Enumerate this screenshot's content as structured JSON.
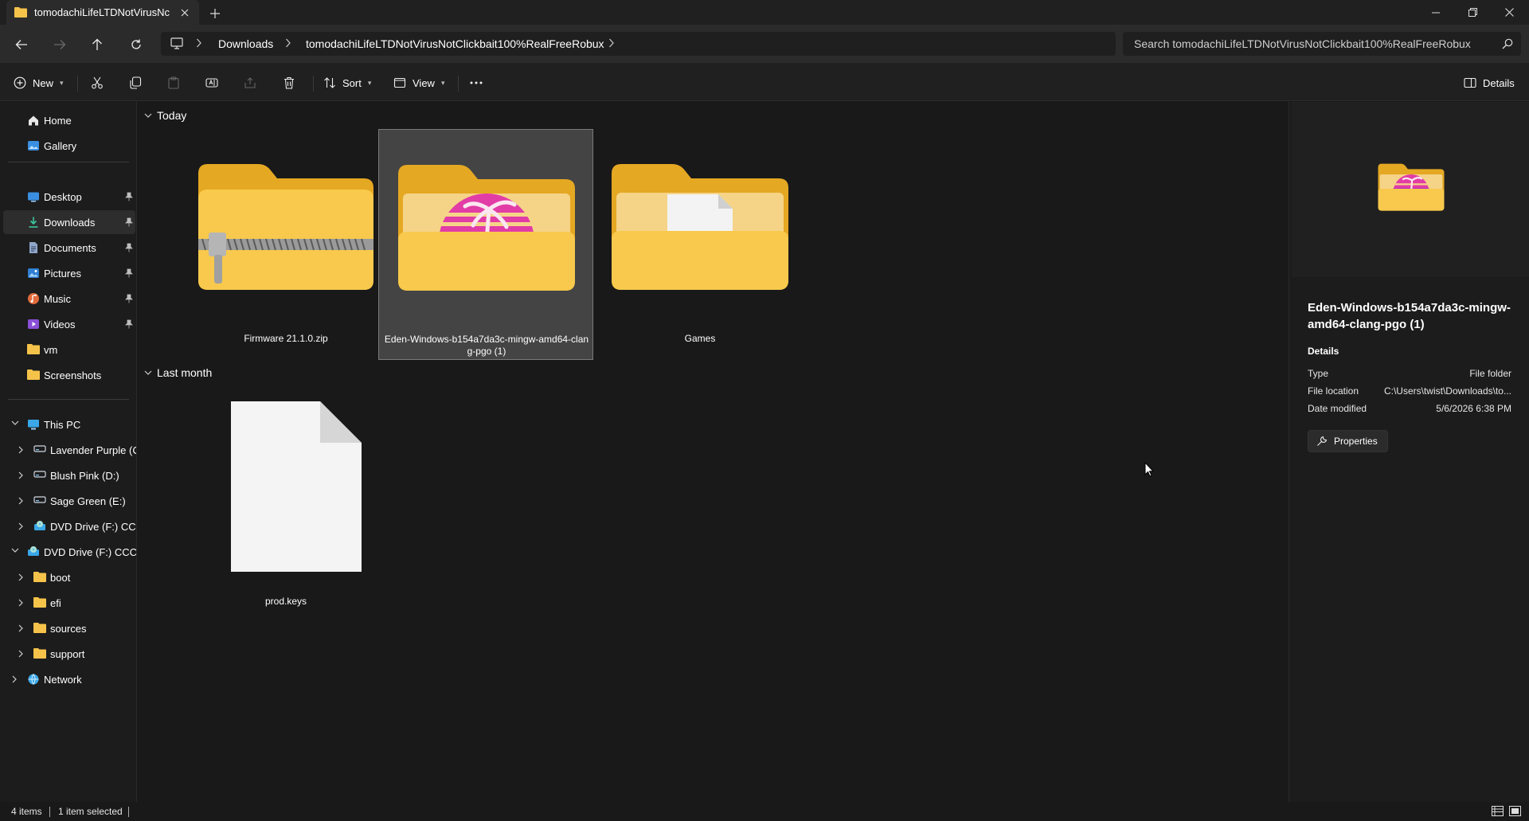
{
  "tab": {
    "title": "tomodachiLifeLTDNotVirusNc",
    "close_icon": "close-icon",
    "new_tab_label": "+"
  },
  "window_controls": [
    "minimize-icon",
    "restore-icon",
    "close-icon"
  ],
  "address_bar": {
    "breadcrumbs": [
      "Downloads",
      "tomodachiLifeLTDNotVirusNotClickbait100%RealFreeRobux"
    ],
    "search_placeholder": "Search tomodachiLifeLTDNotVirusNotClickbait100%RealFreeRobux"
  },
  "toolbar": {
    "new_label": "New",
    "sort_label": "Sort",
    "view_label": "View",
    "details_label": "Details"
  },
  "sidebar": {
    "quick": [
      {
        "label": "Home",
        "icon": "home-icon"
      },
      {
        "label": "Gallery",
        "icon": "gallery-icon"
      }
    ],
    "pinned": [
      {
        "label": "Desktop",
        "icon": "desktop-icon"
      },
      {
        "label": "Downloads",
        "icon": "download-icon"
      },
      {
        "label": "Documents",
        "icon": "documents-icon"
      },
      {
        "label": "Pictures",
        "icon": "pictures-icon"
      },
      {
        "label": "Music",
        "icon": "music-icon"
      },
      {
        "label": "Videos",
        "icon": "videos-icon"
      },
      {
        "label": "vm",
        "icon": "folder-icon"
      },
      {
        "label": "Screenshots",
        "icon": "folder-icon"
      }
    ],
    "tree": [
      {
        "label": "This PC",
        "icon": "pc-icon"
      },
      {
        "label": "Lavender Purple (C:)",
        "icon": "drive-icon"
      },
      {
        "label": "Blush Pink (D:)",
        "icon": "drive-icon"
      },
      {
        "label": "Sage Green (E:)",
        "icon": "drive-icon"
      },
      {
        "label": "DVD Drive (F:) CCCC",
        "icon": "dvd-icon"
      },
      {
        "label": "DVD Drive (F:) CCCOM",
        "icon": "dvd-icon"
      },
      {
        "label": "boot",
        "icon": "folder-icon"
      },
      {
        "label": "efi",
        "icon": "folder-icon"
      },
      {
        "label": "sources",
        "icon": "folder-icon"
      },
      {
        "label": "support",
        "icon": "folder-icon"
      },
      {
        "label": "Network",
        "icon": "network-icon"
      }
    ]
  },
  "groups": [
    {
      "label": "Today",
      "items": [
        {
          "name": "Firmware 21.1.0.zip",
          "icon": "zip-folder-icon"
        },
        {
          "name": "Eden-Windows-b154a7da3c-mingw-amd64-clang-pgo (1)",
          "icon": "eden-folder-icon",
          "selected": true
        },
        {
          "name": "Games",
          "icon": "folder-with-file-icon"
        }
      ]
    },
    {
      "label": "Last month",
      "items": [
        {
          "name": "prod.keys",
          "icon": "file-icon"
        }
      ]
    }
  ],
  "details": {
    "title": "Eden-Windows-b154a7da3c-mingw-amd64-clang-pgo (1)",
    "section": "Details",
    "rows": [
      {
        "k": "Type",
        "v": "File folder"
      },
      {
        "k": "File location",
        "v": "C:\\Users\\twist\\Downloads\\to..."
      },
      {
        "k": "Date modified",
        "v": "5/6/2026 6:38 PM"
      }
    ],
    "properties_label": "Properties"
  },
  "status": {
    "count": "4 items",
    "selected": "1 item selected"
  },
  "colors": {
    "folder": "#f6c34a",
    "folder_dark": "#e5a823",
    "eden_pink": "#e23ca6",
    "eden_purple": "#a02bc7",
    "selection": "#444444"
  }
}
